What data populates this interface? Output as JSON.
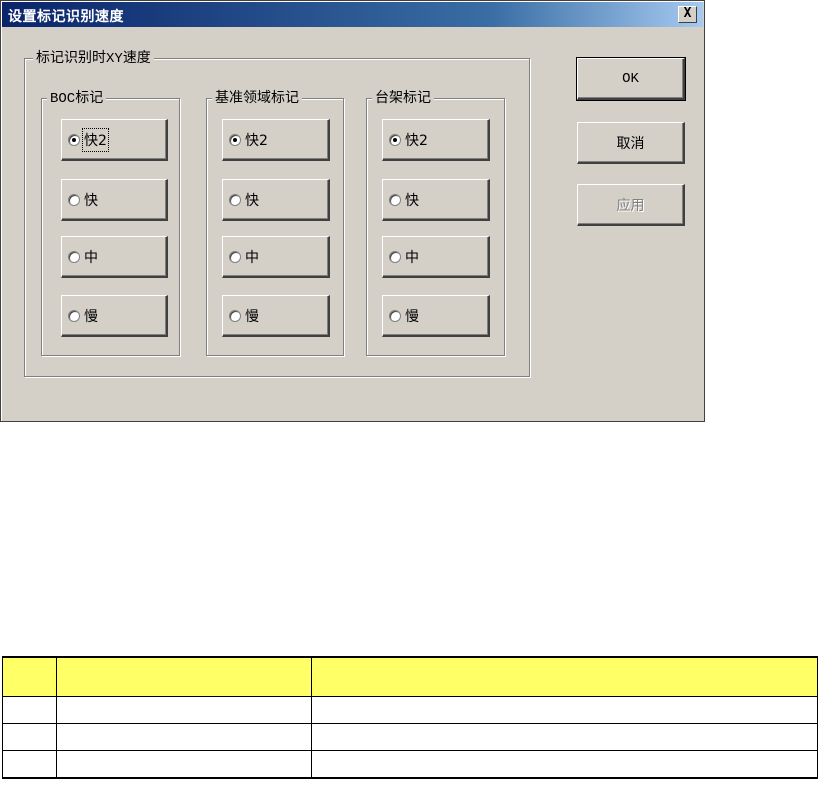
{
  "window": {
    "title": "设置标记识别速度",
    "close_label": "X"
  },
  "outer_group": {
    "legend_prefix": "标记识别时",
    "legend_mono": "XY",
    "legend_suffix": "速度"
  },
  "groups": [
    {
      "legend_mono": "BOC",
      "legend_text": "标记",
      "options": [
        "快2",
        "快",
        "中",
        "慢"
      ],
      "selected": 0
    },
    {
      "legend_mono": "",
      "legend_text": "基准领域标记",
      "options": [
        "快2",
        "快",
        "中",
        "慢"
      ],
      "selected": 0
    },
    {
      "legend_mono": "",
      "legend_text": "台架标记",
      "options": [
        "快2",
        "快",
        "中",
        "慢"
      ],
      "selected": 0
    }
  ],
  "buttons": {
    "ok": "OK",
    "cancel": "取消",
    "apply": "应用"
  },
  "table": {
    "columns": [
      "",
      "",
      ""
    ],
    "rows": [
      [
        "",
        "",
        ""
      ],
      [
        "",
        "",
        ""
      ],
      [
        "",
        "",
        ""
      ]
    ],
    "header_color": "#ffff66"
  }
}
